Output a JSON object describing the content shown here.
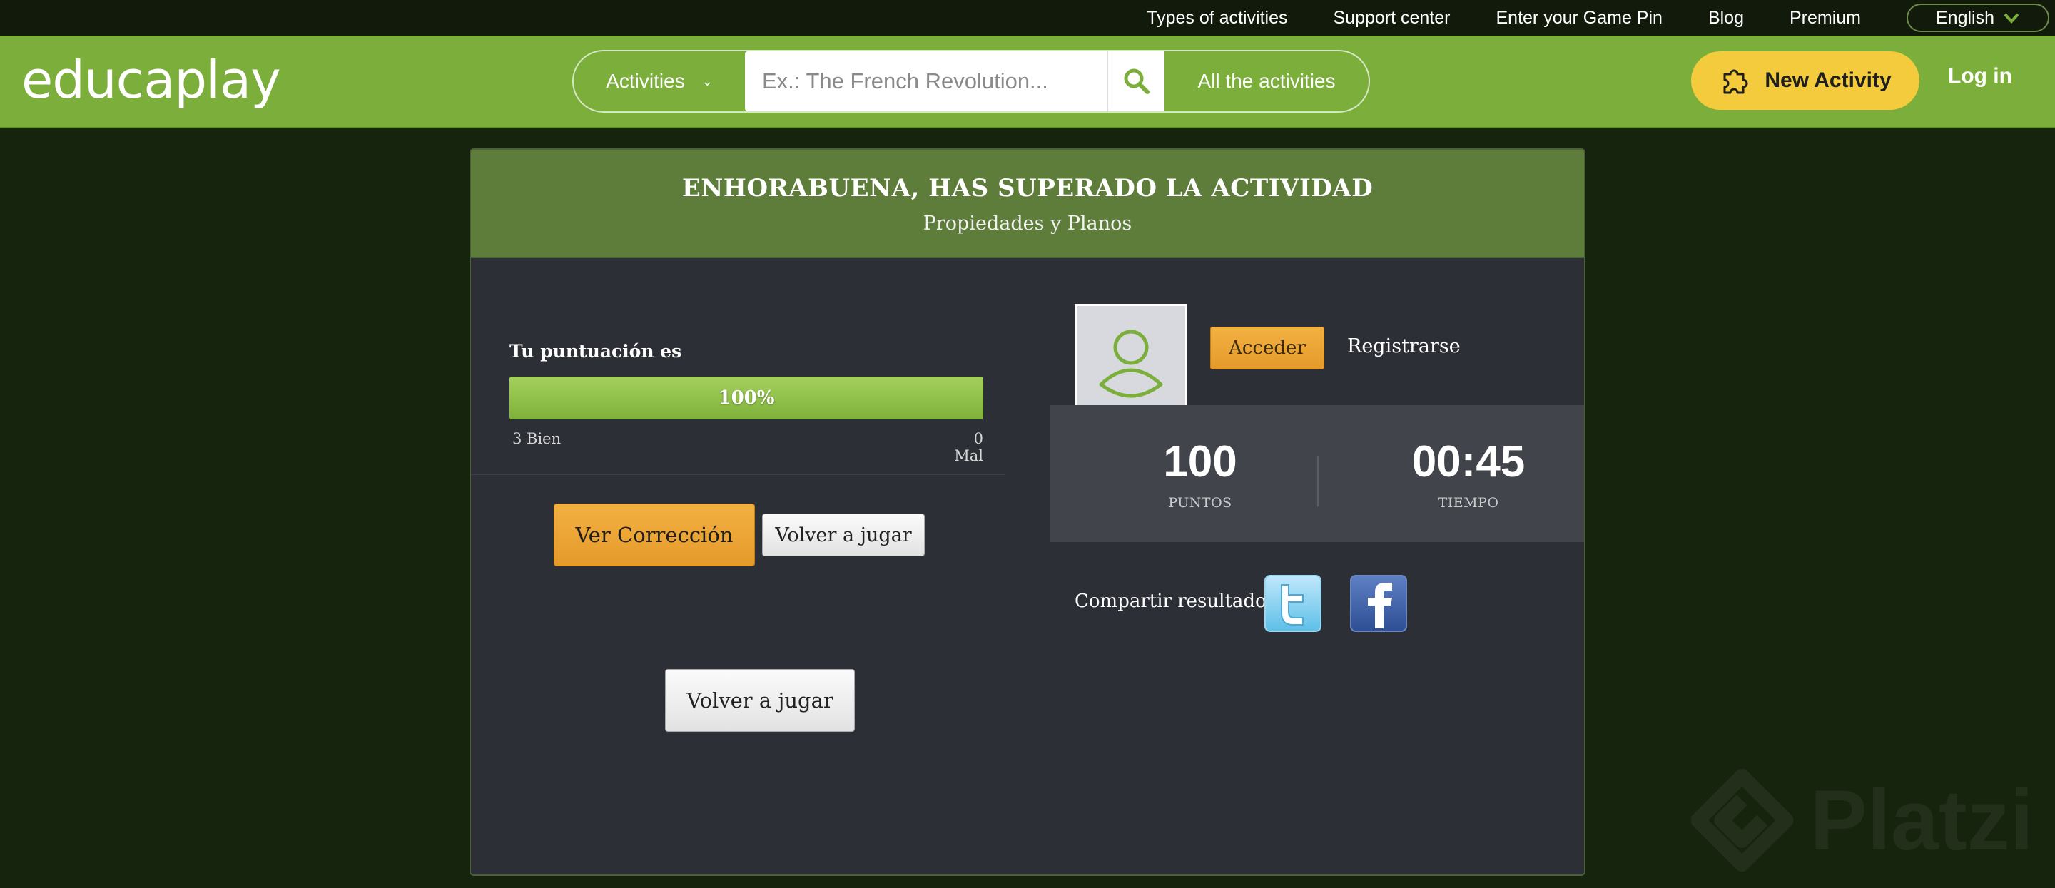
{
  "topbar": {
    "links": [
      "Types of activities",
      "Support center",
      "Enter your Game Pin",
      "Blog",
      "Premium"
    ],
    "language": "English"
  },
  "header": {
    "logo_text": "educaplay",
    "search": {
      "category": "Activities",
      "placeholder": "Ex.: The French Revolution...",
      "all_label": "All the activities"
    },
    "new_activity_label": "New Activity",
    "login_label": "Log in"
  },
  "result": {
    "title": "ENHORABUENA, HAS SUPERADO LA ACTIVIDAD",
    "subtitle": "Propiedades y Planos",
    "score_label": "Tu puntuación es",
    "score_percent_text": "100%",
    "score_fraction": 1.0,
    "correct_text": "3 Bien",
    "wrong_text": "0 Mal",
    "ver_correccion": "Ver Corrección",
    "volver_a_jugar": "Volver a jugar",
    "volver_a_jugar_big": "Volver a jugar"
  },
  "account": {
    "acceder": "Acceder",
    "registrarse": "Registrarse"
  },
  "stats": {
    "points_value": "100",
    "points_label": "PUNTOS",
    "time_value": "00:45",
    "time_label": "TIEMPO"
  },
  "share": {
    "label": "Compartir resultado:",
    "networks": [
      "twitter-icon",
      "facebook-icon"
    ]
  },
  "watermark_text": "Platzi",
  "colors": {
    "header_green": "#7cae3b",
    "accent_yellow": "#f3cb3d",
    "button_orange": "#e59a2a",
    "card_bg": "#2d2f36"
  }
}
